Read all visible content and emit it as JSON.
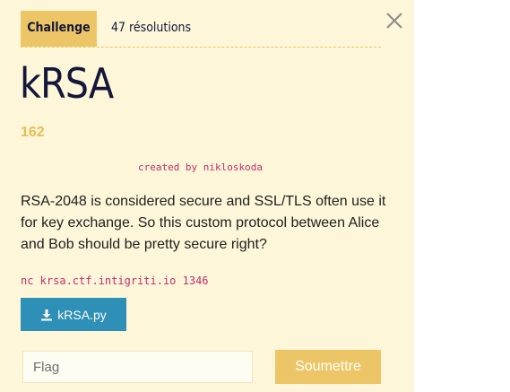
{
  "tabs": {
    "challenge": "Challenge",
    "solves": "47 résolutions"
  },
  "challenge": {
    "name": "kRSA",
    "points": "162",
    "author": "created by nikloskoda",
    "description": "RSA-2048 is considered secure and SSL/TLS often use it for key exchange. So this custom protocol between Alice and Bob should be pretty secure right?",
    "connection": "nc krsa.ctf.intigriti.io 1346",
    "file_label": "kRSA.py"
  },
  "form": {
    "flag_placeholder": "Flag",
    "submit_label": "Soumettre"
  },
  "icons": {
    "close": "close-icon",
    "download": "download-icon"
  },
  "colors": {
    "modal_background": "#fdf6d9",
    "accent": "#ecc666",
    "file_button": "#2e8fb7",
    "code_text": "#c22f6b",
    "title_text": "#14163a"
  }
}
